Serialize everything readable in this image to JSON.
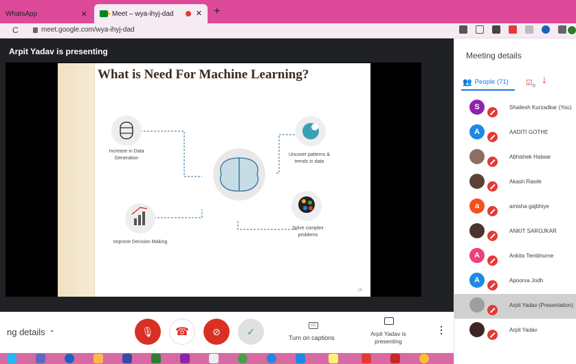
{
  "browser": {
    "tabs": [
      {
        "label": "WhatsApp"
      },
      {
        "label": "Meet – wya-ihyj-dad"
      }
    ],
    "url": "meet.google.com/wya-ihyj-dad"
  },
  "stage": {
    "presenter_label": "Arpit Yadav is presenting"
  },
  "slide": {
    "title": "What is Need For Machine Learning?",
    "page_number": "25",
    "nodes": {
      "data": "Increase in Data Generation",
      "patterns": "Uncover patterns & trends in data",
      "decision": "Improve Decision Making",
      "problems": "Solve complex problems"
    }
  },
  "panel": {
    "title": "Meeting details",
    "people_tab": "People (71)",
    "chat_count": "0",
    "participants": [
      {
        "name": "Shailesh Kurzadkar (You)",
        "initial": "S",
        "color": "#8e24aa"
      },
      {
        "name": "AADITI GOTHE",
        "initial": "A",
        "color": "#1e88e5"
      },
      {
        "name": "Abhishek Hatwar",
        "initial": "",
        "color": "#8d6e63"
      },
      {
        "name": "Akash Rawle",
        "initial": "",
        "color": "#5d4037"
      },
      {
        "name": "amisha gajbhiye",
        "initial": "a",
        "color": "#f4511e"
      },
      {
        "name": "ANKIT SAROJKAR",
        "initial": "",
        "color": "#4e342e"
      },
      {
        "name": "Ankita Tembhurne",
        "initial": "A",
        "color": "#ec407a"
      },
      {
        "name": "Apoorva Jodh",
        "initial": "A",
        "color": "#1e88e5"
      },
      {
        "name": "Arpit Yadav (Presentation)",
        "initial": "",
        "color": "#9e9e9e"
      },
      {
        "name": "Arpit Yadav",
        "initial": "",
        "color": "#3e2723"
      }
    ]
  },
  "controls": {
    "details_label": "ng details",
    "captions_label": "Turn on captions",
    "present_label": "Arpit Yadav is presenting"
  }
}
